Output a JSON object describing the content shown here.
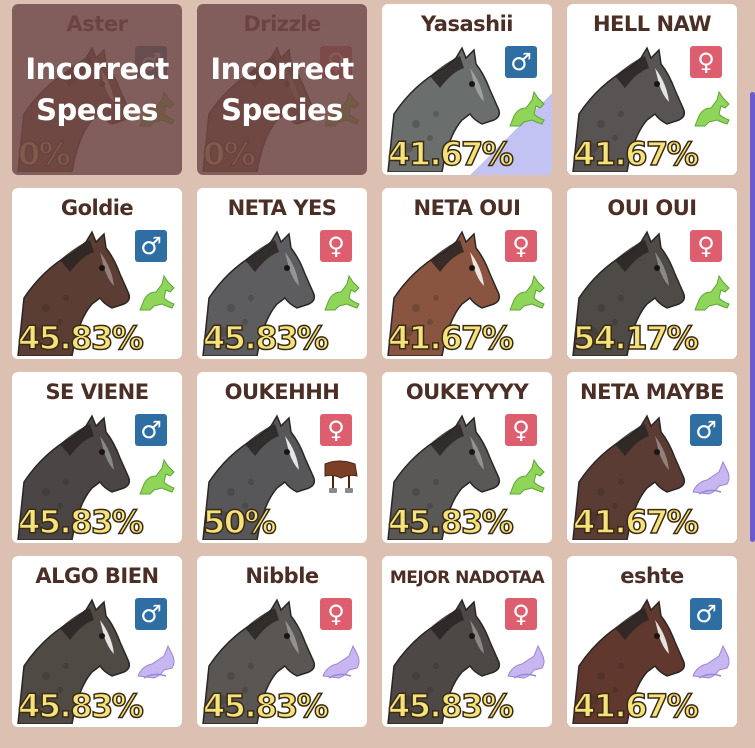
{
  "horses": [
    {
      "name": "Aster",
      "gender": "male",
      "percent": "0%",
      "status": "horse",
      "incorrect": true
    },
    {
      "name": "Drizzle",
      "gender": "female",
      "percent": "0%",
      "status": "horse",
      "incorrect": true
    },
    {
      "name": "Yasashii",
      "gender": "male",
      "percent": "41.67%",
      "status": "horse",
      "coat": "#6a6e6c",
      "breeding": true
    },
    {
      "name": "HELL NAW",
      "gender": "female",
      "percent": "41.67%",
      "status": "horse",
      "coat": "#585453"
    },
    {
      "name": "Goldie",
      "gender": "male",
      "percent": "45.83%",
      "status": "horse",
      "coat": "#5c3d33"
    },
    {
      "name": "NETA YES",
      "gender": "female",
      "percent": "45.83%",
      "status": "horse",
      "coat": "#5d5d5f"
    },
    {
      "name": "NETA OUI",
      "gender": "female",
      "percent": "41.67%",
      "status": "horse",
      "coat": "#8a5540"
    },
    {
      "name": "OUI OUI",
      "gender": "female",
      "percent": "54.17%",
      "status": "horse",
      "coat": "#4e4a45"
    },
    {
      "name": "SE VIENE",
      "gender": "male",
      "percent": "45.83%",
      "status": "horse",
      "coat": "#4b4645"
    },
    {
      "name": "OUKEHHH",
      "gender": "female",
      "percent": "50%",
      "status": "saddle",
      "coat": "#57575a"
    },
    {
      "name": "OUKEYYYY",
      "gender": "female",
      "percent": "45.83%",
      "status": "horse",
      "coat": "#5a5857"
    },
    {
      "name": "NETA MAYBE",
      "gender": "male",
      "percent": "41.67%",
      "status": "foal",
      "coat": "#5a3c34"
    },
    {
      "name": "ALGO BIEN",
      "gender": "male",
      "percent": "45.83%",
      "status": "foal",
      "coat": "#4f4a43"
    },
    {
      "name": "Nibble",
      "gender": "female",
      "percent": "45.83%",
      "status": "foal",
      "coat": "#595654"
    },
    {
      "name": "MEJOR NADOTAA",
      "gender": "female",
      "percent": "45.83%",
      "status": "foal",
      "coat": "#4d4845"
    },
    {
      "name": "eshte",
      "gender": "male",
      "percent": "41.67%",
      "status": "foal",
      "coat": "#60382d"
    }
  ],
  "overlay_text": "Incorrect\nSpecies",
  "icons": {
    "male": "♂",
    "female": "♀"
  },
  "colors": {
    "page_bg": "#dcc1b2",
    "name_text": "#4b2e25",
    "male": "#2f6ea3",
    "female": "#dd5f6f",
    "percent_fill": "#f4e27a",
    "status_horse": "#8fd55a",
    "status_foal": "#c8b6f0"
  }
}
